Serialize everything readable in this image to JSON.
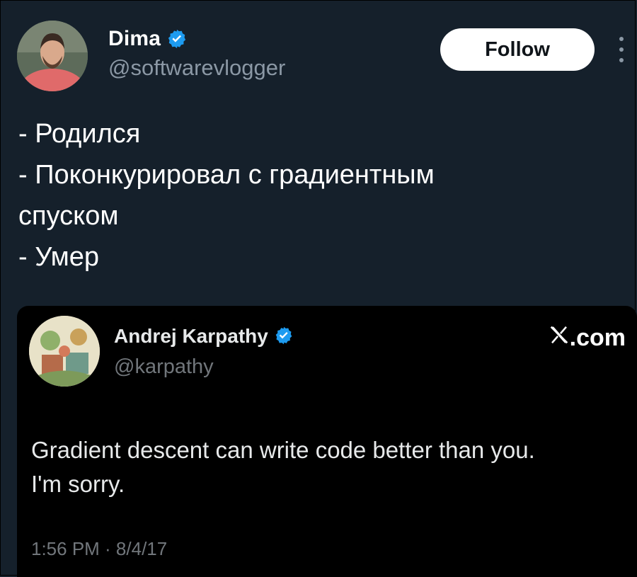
{
  "tweet": {
    "author_name": "Dima",
    "author_handle": "@softwarevlogger",
    "follow_label": "Follow",
    "lines": [
      "- Родился",
      "- Поконкурировал с градиентным",
      "спуском",
      "- Умер"
    ]
  },
  "quoted": {
    "author_name": "Andrej Karpathy",
    "author_handle": "@karpathy",
    "site_label": ".com",
    "site_icon": "x-logo-icon",
    "lines": [
      "Gradient descent can write code better than you.",
      "I'm sorry."
    ],
    "timestamp": "1:56 PM · 8/4/17"
  },
  "colors": {
    "background": "#15202b",
    "quote_background": "#000000",
    "verified_badge": "#1d9bf0",
    "secondary_text": "#8b98a5"
  }
}
